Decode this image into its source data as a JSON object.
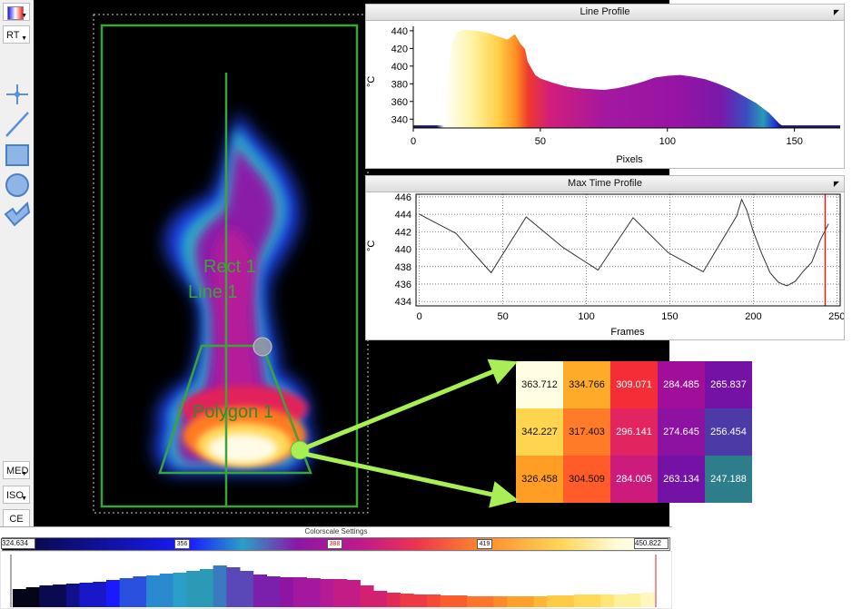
{
  "toolbar": {
    "palette_label": "",
    "rt_label": "RT",
    "med_label": "MED",
    "iso_label": "ISO",
    "ce_label": "CE"
  },
  "overlay": {
    "rect_label": "Rect 1",
    "line_label": "Line 1",
    "polygon_label": "Polygon 1"
  },
  "line_profile": {
    "title": "Line Profile",
    "y_unit": "°C",
    "x_label": "Pixels",
    "y_ticks": [
      "440",
      "420",
      "400",
      "380",
      "360",
      "340"
    ],
    "x_ticks": [
      "0",
      "50",
      "100",
      "150"
    ]
  },
  "max_time_profile": {
    "title": "Max Time Profile",
    "y_unit": "°C",
    "x_label": "Frames",
    "y_ticks": [
      "446",
      "444",
      "442",
      "440",
      "438",
      "436",
      "434"
    ],
    "x_ticks": [
      "0",
      "50",
      "100",
      "150",
      "200",
      "250"
    ]
  },
  "chart_data": [
    {
      "type": "area",
      "title": "Line Profile",
      "xlabel": "Pixels",
      "ylabel": "°C",
      "xlim": [
        0,
        168
      ],
      "ylim": [
        330,
        445
      ],
      "x": [
        0,
        12,
        13,
        14,
        15,
        17,
        20,
        25,
        30,
        35,
        37,
        38,
        40,
        41,
        42,
        44,
        45,
        48,
        50,
        55,
        60,
        65,
        70,
        75,
        80,
        85,
        90,
        95,
        100,
        105,
        110,
        115,
        120,
        125,
        130,
        135,
        140,
        143,
        144,
        145,
        148,
        168
      ],
      "y": [
        333,
        333,
        365,
        395,
        425,
        438,
        441,
        440,
        437,
        432,
        430,
        432,
        436,
        431,
        426,
        419,
        405,
        390,
        386,
        381,
        377,
        375,
        374,
        373,
        375,
        378,
        382,
        387,
        389,
        390,
        388,
        385,
        380,
        374,
        366,
        358,
        347,
        338,
        335,
        333,
        333,
        333
      ]
    },
    {
      "type": "line",
      "title": "Max Time Profile",
      "xlabel": "Frames",
      "ylabel": "°C",
      "xlim": [
        -2,
        252
      ],
      "ylim": [
        433.5,
        446.3
      ],
      "x": [
        0,
        22,
        43,
        64,
        86,
        107,
        128,
        149,
        170,
        190,
        193,
        196,
        200,
        205,
        210,
        215,
        220,
        225,
        230,
        235,
        240,
        245
      ],
      "y": [
        444.0,
        441.8,
        437.3,
        443.7,
        440.2,
        437.6,
        443.6,
        439.6,
        437.4,
        443.8,
        445.7,
        444.5,
        442.0,
        439.5,
        437.3,
        436.2,
        435.8,
        436.3,
        437.5,
        438.5,
        441.0,
        442.9
      ],
      "marker_x": 243
    }
  ],
  "matrix": {
    "rows": [
      [
        "363.712",
        "334.766",
        "309.071",
        "284.485",
        "265.837"
      ],
      [
        "342.227",
        "317.403",
        "296.141",
        "274.645",
        "256.454"
      ],
      [
        "326.458",
        "304.509",
        "284.005",
        "263.134",
        "247.188"
      ]
    ],
    "colors": [
      [
        "#fffde2",
        "#ffab2a",
        "#f42d37",
        "#a10f9a",
        "#7312a5"
      ],
      [
        "#ffd550",
        "#ff7b28",
        "#e22560",
        "#8d12a2",
        "#4c3aa7"
      ],
      [
        "#ff9d25",
        "#ff5c2a",
        "#cc1b7a",
        "#7412a5",
        "#2d7d8a"
      ]
    ],
    "text_colors": [
      [
        "#111111",
        "#111111",
        "#ffffff",
        "#ffffff",
        "#ffffff"
      ],
      [
        "#111111",
        "#111111",
        "#ffffff",
        "#ffffff",
        "#ffffff"
      ],
      [
        "#111111",
        "#111111",
        "#ffffff",
        "#ffffff",
        "#ffffff"
      ]
    ]
  },
  "colorscale": {
    "title": "Colorscale Settings",
    "min_value": "324.634",
    "max_value": "450.822",
    "marker1": "356",
    "marker2": "388",
    "marker3": "419"
  },
  "colors": {
    "roi_green": "#3aa43a",
    "arrow_green": "#a8ef55",
    "marker_red": "#e02020"
  }
}
